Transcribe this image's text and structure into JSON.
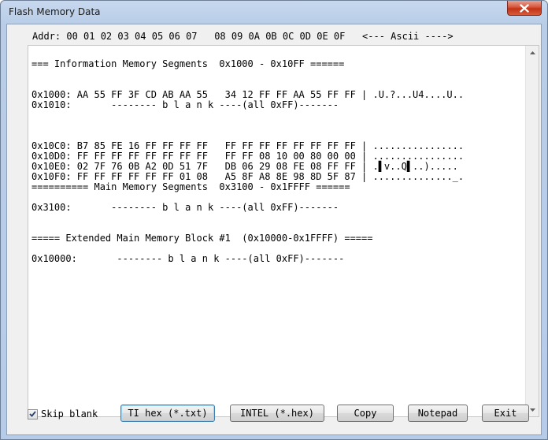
{
  "window": {
    "title": "Flash Memory Data"
  },
  "addr_header": "Addr: 00 01 02 03 04 05 06 07   08 09 0A 0B 0C 0D 0E 0F   <--- Ascii ---->",
  "memory_lines": [
    "",
    "=== Information Memory Segments  0x1000 - 0x10FF ======",
    "",
    "",
    "0x1000: AA 55 FF 3F CD AB AA 55   34 12 FF FF AA 55 FF FF | .U.?...U4....U..",
    "0x1010:       -------- b l a n k ----(all 0xFF)-------",
    "",
    "",
    "",
    "0x10C0: B7 85 FE 16 FF FF FF FF   FF FF FF FF FF FF FF FF | ................",
    "0x10D0: FF FF FF FF FF FF FF FF   FF FF 08 10 00 80 00 00 | ................",
    "0x10E0: 02 7F 76 0B A2 0D 51 7F   DB 06 29 08 FE 08 FF FF | .▌v..Q▌..).....",
    "0x10F0: FF FF FF FF FF FF 01 08   A5 8F A8 8E 98 8D 5F 87 | .............._.",
    "========== Main Memory Segments  0x3100 - 0x1FFFF ======",
    "",
    "0x3100:       -------- b l a n k ----(all 0xFF)-------",
    "",
    "",
    "===== Extended Main Memory Block #1  (0x10000-0x1FFFF) =====",
    "",
    "0x10000:       -------- b l a n k ----(all 0xFF)-------"
  ],
  "footer": {
    "skip_blank_label": "Skip blank",
    "skip_blank_checked": true,
    "buttons": {
      "ti_hex": "TI hex (*.txt)",
      "intel_hex": "INTEL (*.hex)",
      "copy": "Copy",
      "notepad": "Notepad",
      "exit": "Exit"
    }
  }
}
